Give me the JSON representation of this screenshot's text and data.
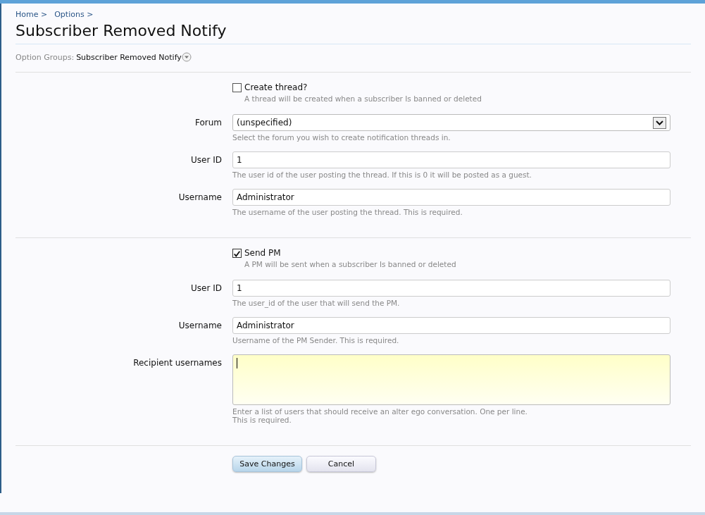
{
  "breadcrumb": [
    {
      "label": "Home >"
    },
    {
      "label": "Options >"
    }
  ],
  "title": "Subscriber Removed Notify",
  "option_groups": {
    "label": "Option Groups:",
    "value": "Subscriber Removed Notify"
  },
  "sections": [
    {
      "toggle": {
        "label": "Create thread?",
        "checked": false,
        "hint": "A thread will be created when a subscriber Is banned or deleted"
      },
      "fields": [
        {
          "kind": "select",
          "label": "Forum",
          "value": "(unspecified)",
          "hint": [
            "Select the forum you wish to create notification threads in."
          ]
        },
        {
          "kind": "text",
          "label": "User ID",
          "value": "1",
          "hint": [
            "The user id of the user posting the thread. If this is 0 it will be posted as a guest."
          ]
        },
        {
          "kind": "text",
          "label": "Username",
          "value": "Administrator",
          "hint": [
            "The username of the user posting the thread. This is required."
          ]
        }
      ]
    },
    {
      "toggle": {
        "label": "Send PM",
        "checked": true,
        "hint": "A PM will be sent when a subscriber Is banned or deleted"
      },
      "fields": [
        {
          "kind": "text",
          "label": "User ID",
          "value": "1",
          "hint": [
            "The user_id of the user that will send the PM."
          ]
        },
        {
          "kind": "text",
          "label": "Username",
          "value": "Administrator",
          "hint": [
            "Username of the PM Sender. This is required."
          ]
        },
        {
          "kind": "textarea",
          "label": "Recipient usernames",
          "focused": true,
          "hint": [
            "Enter a list of users that should receive an alter ego conversation. One per line.",
            "This is required."
          ]
        }
      ]
    }
  ],
  "buttons": [
    {
      "label": "Save Changes",
      "kind": "primary"
    },
    {
      "label": "Cancel",
      "kind": "secondary"
    }
  ]
}
